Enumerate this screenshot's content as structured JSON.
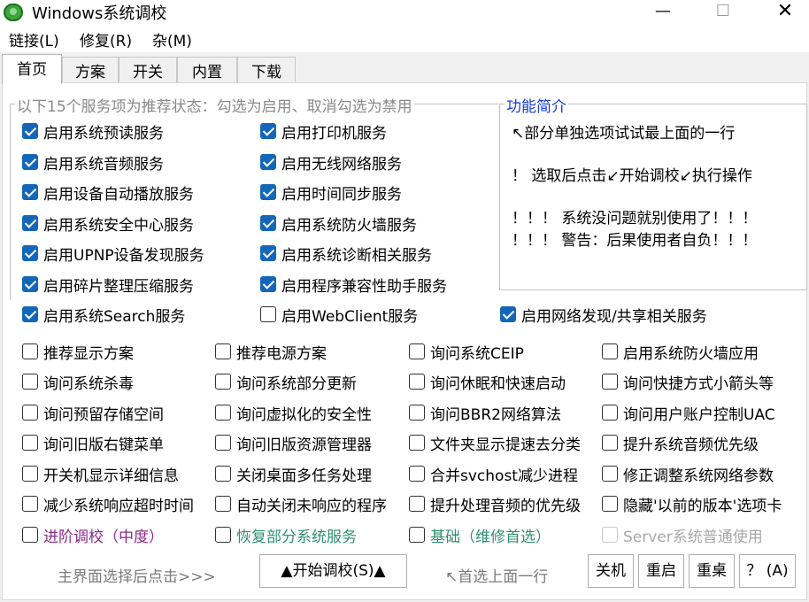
{
  "window": {
    "title": "Windows系统调校",
    "min_glyph": "—",
    "max_glyph": "☐",
    "close_glyph": "✕"
  },
  "menu": [
    "链接(L)",
    "修复(R)",
    "杂(M)"
  ],
  "tabs": [
    "首页",
    "方案",
    "开关",
    "内置",
    "下载"
  ],
  "services": {
    "legend": "以下15个服务项为推荐状态：勾选为启用、取消勾选为禁用",
    "items": [
      {
        "label": "启用系统预读服务",
        "checked": true
      },
      {
        "label": "启用系统音频服务",
        "checked": true
      },
      {
        "label": "启用设备自动播放服务",
        "checked": true
      },
      {
        "label": "启用系统安全中心服务",
        "checked": true
      },
      {
        "label": "启用UPNP设备发现服务",
        "checked": true
      },
      {
        "label": "启用碎片整理压缩服务",
        "checked": true
      },
      {
        "label": "启用系统Search服务",
        "checked": true
      },
      {
        "label": "启用打印机服务",
        "checked": true
      },
      {
        "label": "启用无线网络服务",
        "checked": true
      },
      {
        "label": "启用时间同步服务",
        "checked": true
      },
      {
        "label": "启用系统防火墙服务",
        "checked": true
      },
      {
        "label": "启用系统诊断相关服务",
        "checked": true
      },
      {
        "label": "启用程序兼容性助手服务",
        "checked": true
      },
      {
        "label": "启用WebClient服务",
        "checked": false
      },
      {
        "label": "启用网络发现/共享相关服务",
        "checked": true
      }
    ]
  },
  "info": {
    "legend": "功能简介",
    "legend_color": "#1a3cd0",
    "lines": [
      "↖部分单独选项试试最上面的一行",
      "！ 选取后点击↙开始调校↙执行操作",
      "！！！ 系统没问题就别使用了！！！",
      "！！！ 警告：后果使用者自负！！！"
    ]
  },
  "options": [
    {
      "label": "推荐显示方案"
    },
    {
      "label": "询问系统杀毒"
    },
    {
      "label": "询问预留存储空间"
    },
    {
      "label": "询问旧版右键菜单"
    },
    {
      "label": "开关机显示详细信息"
    },
    {
      "label": "减少系统响应超时时间"
    },
    {
      "label": "推荐电源方案"
    },
    {
      "label": "询问系统部分更新"
    },
    {
      "label": "询问虚拟化的安全性"
    },
    {
      "label": "询问旧版资源管理器"
    },
    {
      "label": "关闭桌面多任务处理"
    },
    {
      "label": "自动关闭未响应的程序"
    },
    {
      "label": "询问系统CEIP"
    },
    {
      "label": "询问休眠和快速启动"
    },
    {
      "label": "询问BBR2网络算法"
    },
    {
      "label": "文件夹显示提速去分类"
    },
    {
      "label": "合并svchost减少进程"
    },
    {
      "label": "提升处理音频的优先级"
    },
    {
      "label": "启用系统防火墙应用"
    },
    {
      "label": "询问快捷方式小箭头等"
    },
    {
      "label": "询问用户账户控制UAC"
    },
    {
      "label": "提升系统音频优先级"
    },
    {
      "label": "修正调整系统网络参数"
    },
    {
      "label": "隐藏'以前的版本'选项卡"
    }
  ],
  "presets": [
    {
      "label": "进阶调校（中度）",
      "color": "#8a2a8a"
    },
    {
      "label": "恢复部分系统服务",
      "color": "#2f8f6f"
    },
    {
      "label": "基础（维修首选）",
      "color": "#2f8f6f"
    },
    {
      "label": "Server系统普通使用",
      "color": "#a8a8a8",
      "disabled": true
    }
  ],
  "bottom": {
    "hint_left": "主界面选择后点击>>>",
    "start_button": "▲开始调校(S)▲",
    "hint_right": "↖首选上面一行",
    "shutdown_button": "关机",
    "restart_button": "重启",
    "reload_desktop_button": "重桌",
    "help_button": "？ (A)"
  }
}
